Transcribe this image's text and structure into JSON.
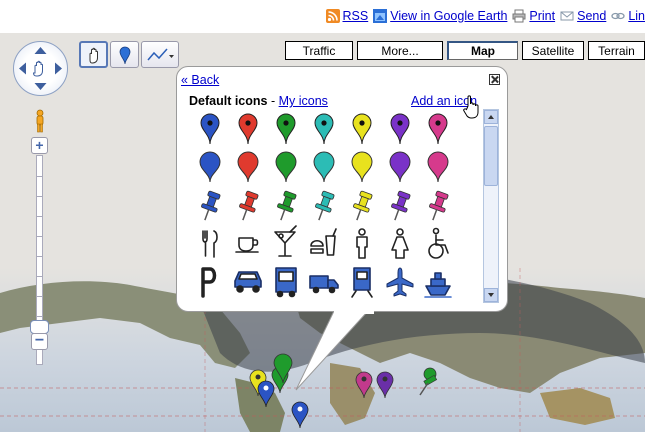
{
  "topbar": {
    "links": [
      {
        "label": "RSS",
        "icon": "rss-icon"
      },
      {
        "label": "View in Google Earth",
        "icon": "google-earth-icon"
      },
      {
        "label": "Print",
        "icon": "printer-icon"
      },
      {
        "label": "Send",
        "icon": "envelope-icon"
      },
      {
        "label": "Lin",
        "icon": "chain-link-icon"
      }
    ]
  },
  "map_controls": {
    "map_types": [
      "Traffic",
      "More...",
      "Map",
      "Satellite",
      "Terrain"
    ],
    "active_map_type": "Map",
    "tools": [
      "hand-tool-icon",
      "placemark-tool-icon",
      "polyline-tool-icon"
    ]
  },
  "icon_picker": {
    "back_label": "« Back",
    "section_title": "Default icons",
    "separator": " - ",
    "my_icons_label": "My icons",
    "add_icon_label": "Add an icon",
    "colors": [
      "#2b54c4",
      "#e03a2e",
      "#1f9b2c",
      "#2cbcb5",
      "#e8e21e",
      "#7a32c8",
      "#d63a8c"
    ],
    "rows": [
      {
        "kind": "small-pin",
        "icons": [
          "blue-dot-pin",
          "red-dot-pin",
          "green-dot-pin",
          "teal-dot-pin",
          "yellow-dot-pin",
          "purple-dot-pin",
          "pink-dot-pin"
        ]
      },
      {
        "kind": "large-pin",
        "icons": [
          "blue-pin",
          "red-pin",
          "green-pin",
          "teal-pin",
          "yellow-pin",
          "purple-pin",
          "pink-pin"
        ]
      },
      {
        "kind": "pushpin",
        "icons": [
          "blue-pushpin",
          "red-pushpin",
          "green-pushpin",
          "teal-pushpin",
          "yellow-pushpin",
          "purple-pushpin",
          "pink-pushpin"
        ]
      },
      {
        "kind": "amenity",
        "icons": [
          "restaurant-icon",
          "coffee-icon",
          "bar-icon",
          "fast-food-icon",
          "man-icon",
          "woman-icon",
          "wheelchair-icon"
        ]
      },
      {
        "kind": "transport",
        "icons": [
          "parking-icon",
          "car-icon",
          "bus-icon",
          "truck-icon",
          "train-icon",
          "airplane-icon",
          "ship-icon"
        ]
      }
    ]
  },
  "map_markers": [
    {
      "icon": "yellow-pin"
    },
    {
      "icon": "green-pin"
    },
    {
      "icon": "blue-pin"
    },
    {
      "icon": "purple-pin"
    },
    {
      "icon": "pink-pin"
    },
    {
      "icon": "green-pushpin"
    }
  ]
}
